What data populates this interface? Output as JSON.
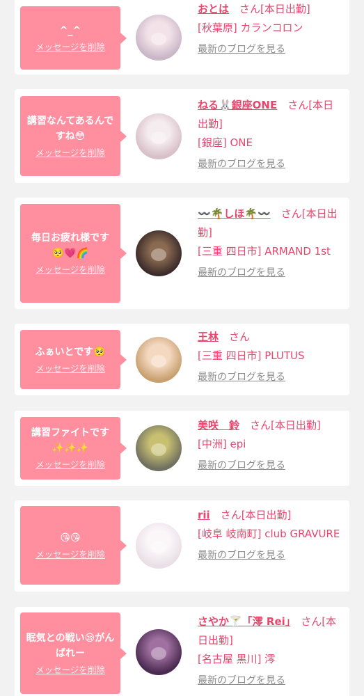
{
  "colors": {
    "accent": "#e9456d",
    "bubble": "#ff8e9f",
    "card": "#ffffff",
    "background": "#f2f2f2",
    "muted": "#8c8c8c"
  },
  "common": {
    "delete_label": "メッセージを削除",
    "blog_label": "最新のブログを見る"
  },
  "entries": [
    {
      "message": "^_^",
      "name": "おとは",
      "suffix": "　さん[本日出勤]",
      "shop": "[秋葉原] カランコロン",
      "avatar_colors": [
        "#c9b7c8",
        "#f3e3e8"
      ]
    },
    {
      "message": "講習なんてあるんですね😳",
      "name": "ねる🐰銀座ONE",
      "suffix": "　さん[本日出勤]",
      "shop": "[銀座] ONE",
      "avatar_colors": [
        "#d8c0c8",
        "#f5ecef"
      ]
    },
    {
      "message": "毎日お疲れ様です🥺💗🌈",
      "name": "〰️🌴しほ🌴〰️",
      "suffix": "　さん[本日出勤]",
      "shop": "[三重 四日市] ARMAND 1st",
      "avatar_colors": [
        "#3a2a2a",
        "#8a6a50"
      ]
    },
    {
      "message": "ふぁいとです🥺",
      "name": "王林",
      "suffix": "　さん",
      "shop": "[三重 四日市] PLUTUS",
      "avatar_colors": [
        "#c8a070",
        "#f4d8c0"
      ]
    },
    {
      "message": "講習ファイトです✨✨✨",
      "name": "美咲　鈴",
      "suffix": "　さん[本日出勤]",
      "shop": "[中洲] epi",
      "avatar_colors": [
        "#707060",
        "#c8c070"
      ]
    },
    {
      "message": "😘😘",
      "name": "rii",
      "suffix": "　さん[本日出勤]",
      "shop": "[岐阜 岐南町] club GRAVURE",
      "avatar_colors": [
        "#e8e0e6",
        "#fbf6f8"
      ]
    },
    {
      "message": "眠気との戦い😪がんばれー",
      "name": "さやか🍸「澪 Rei」",
      "suffix": "　さん[本日出勤]",
      "shop": "[名古屋 黒川] 澪",
      "avatar_colors": [
        "#4a2a50",
        "#a070a0"
      ]
    }
  ]
}
